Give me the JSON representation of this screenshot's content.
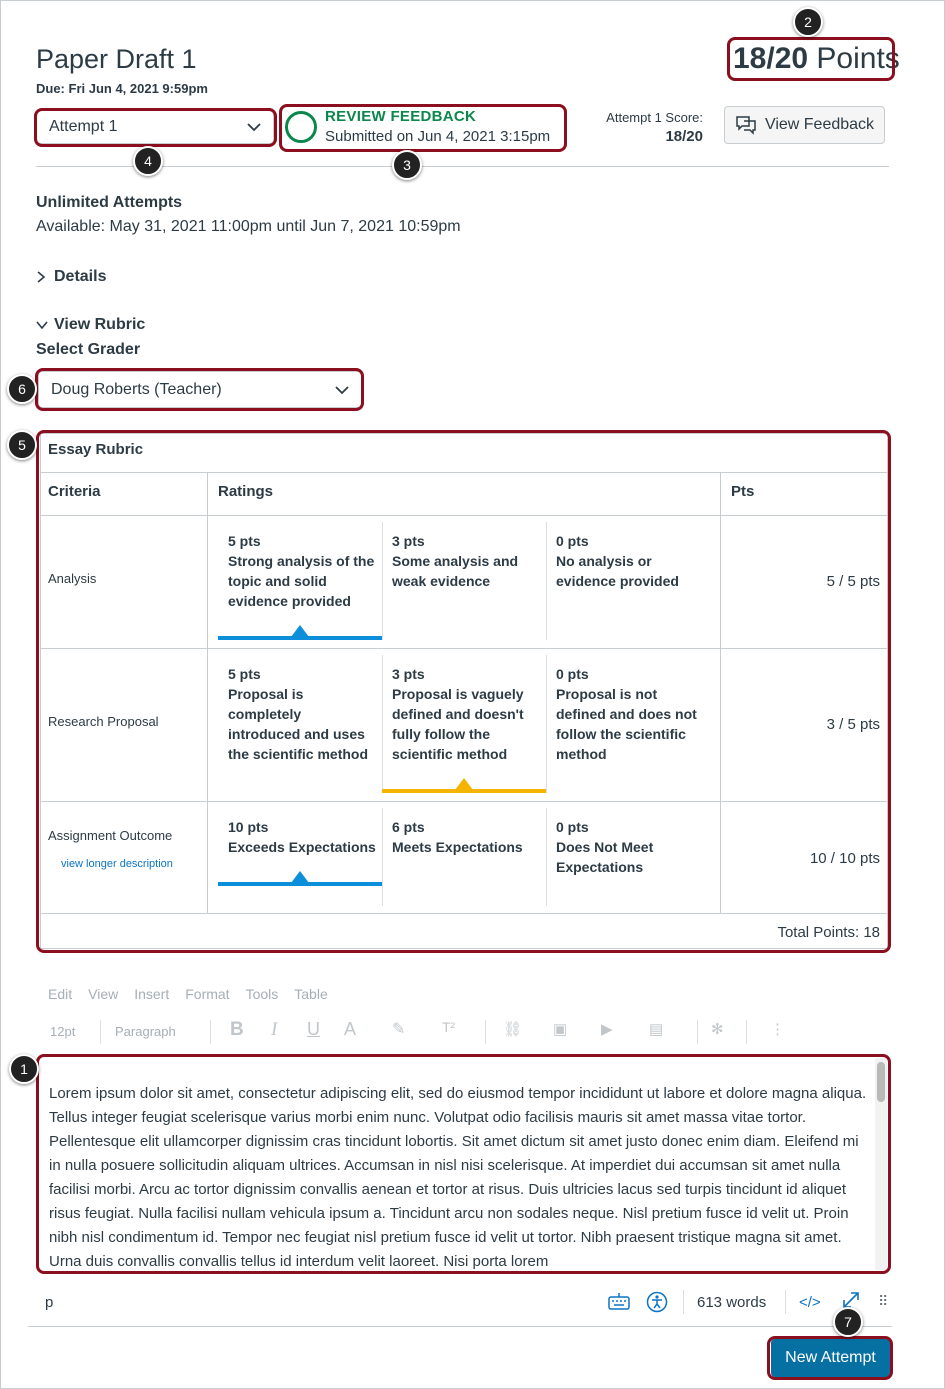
{
  "header": {
    "title": "Paper Draft 1",
    "due": "Due: Fri Jun 4, 2021 9:59pm",
    "points_earned": "18/20",
    "points_label": "Points"
  },
  "attempt_select": {
    "value": "Attempt 1"
  },
  "status": {
    "label": "REVIEW FEEDBACK",
    "submitted": "Submitted on Jun 4, 2021 3:15pm"
  },
  "score": {
    "label": "Attempt 1 Score:",
    "value": "18/20"
  },
  "view_feedback_label": "View Feedback",
  "details": {
    "attempts": "Unlimited Attempts",
    "available": "Available: May 31, 2021 11:00pm until Jun 7, 2021 10:59pm",
    "details_toggle": "Details",
    "rubric_toggle": "View Rubric",
    "select_grader_label": "Select Grader"
  },
  "grader_select": {
    "value": "Doug Roberts (Teacher)"
  },
  "rubric": {
    "title": "Essay Rubric",
    "headers": {
      "criteria": "Criteria",
      "ratings": "Ratings",
      "pts": "Pts"
    },
    "rows": [
      {
        "criterion": "Analysis",
        "ratings": [
          {
            "pts": "5 pts",
            "desc": "Strong analysis of the topic and solid evidence provided"
          },
          {
            "pts": "3 pts",
            "desc": "Some analysis and weak evidence"
          },
          {
            "pts": "0 pts",
            "desc": "No analysis or evidence provided"
          }
        ],
        "score": "5 / 5 pts",
        "selected_index": 0
      },
      {
        "criterion": "Research Proposal",
        "ratings": [
          {
            "pts": "5 pts",
            "desc": "Proposal is completely introduced and uses the scientific method"
          },
          {
            "pts": "3 pts",
            "desc": "Proposal is vaguely defined and doesn't fully follow the scientific method"
          },
          {
            "pts": "0 pts",
            "desc": "Proposal is not defined and does not follow the scientific method"
          }
        ],
        "score": "3 / 5 pts",
        "selected_index": 1
      },
      {
        "criterion": "Assignment Outcome",
        "link": "view longer description",
        "ratings": [
          {
            "pts": "10 pts",
            "desc": "Exceeds Expectations"
          },
          {
            "pts": "6 pts",
            "desc": "Meets Expectations"
          },
          {
            "pts": "0 pts",
            "desc": "Does Not Meet Expectations"
          }
        ],
        "score": "10 / 10 pts",
        "selected_index": 0
      }
    ],
    "total": "Total Points: 18"
  },
  "editor": {
    "menu": [
      "Edit",
      "View",
      "Insert",
      "Format",
      "Tools",
      "Table"
    ],
    "font_size": "12pt",
    "block_format": "Paragraph",
    "content": "Lorem ipsum dolor sit amet, consectetur adipiscing elit, sed do eiusmod tempor incididunt ut labore et dolore magna aliqua. Tellus integer feugiat scelerisque varius morbi enim nunc. Volutpat odio facilisis mauris sit amet massa vitae tortor. Pellentesque elit ullamcorper dignissim cras tincidunt lobortis. Sit amet dictum sit amet justo donec enim diam. Eleifend mi in nulla posuere sollicitudin aliquam ultrices. Accumsan in nisl nisi scelerisque. At imperdiet dui accumsan sit amet nulla facilisi morbi. Arcu ac tortor dignissim convallis aenean et tortor at risus. Duis ultricies lacus sed turpis tincidunt id aliquet risus feugiat. Nulla facilisi nullam vehicula ipsum a. Tincidunt arcu non sodales neque. Nisl pretium fusce id velit ut. Proin nibh nisl condimentum id. Tempor nec feugiat nisl pretium fusce id velit ut tortor. Nibh praesent tristique magna sit amet. Urna duis convallis convallis tellus id interdum velit laoreet. Nisi porta lorem",
    "status_path": "p",
    "word_count": "613 words",
    "html_toggle": "</>"
  },
  "new_attempt_label": "New Attempt",
  "callouts": [
    "1",
    "2",
    "3",
    "4",
    "5",
    "6",
    "7"
  ],
  "colors": {
    "callout": "#8b0f1e",
    "review_green": "#0b874b",
    "selected_blue": "#0b8fdb",
    "selected_yellow": "#f5b400",
    "primary_button": "#0770a3"
  }
}
